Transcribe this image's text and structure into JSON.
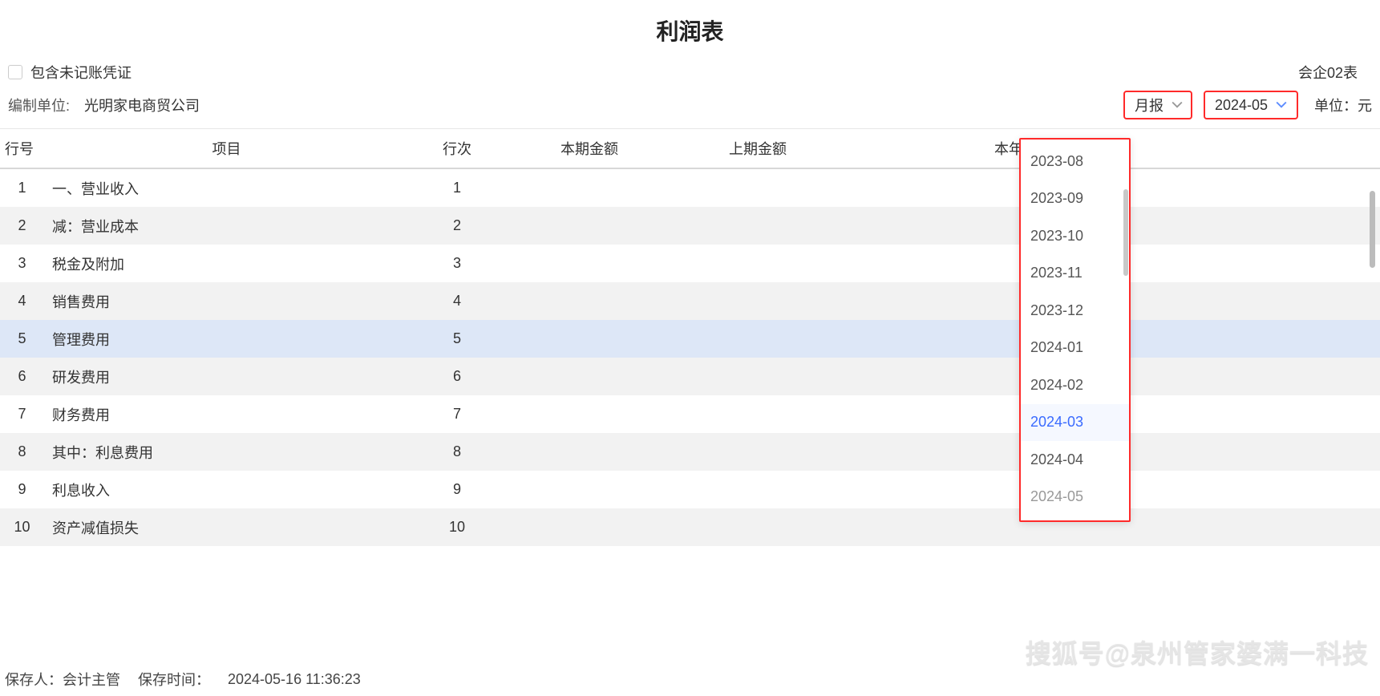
{
  "title": "利润表",
  "checkbox_label": "包含未记账凭证",
  "form_code_label": "会企02表",
  "org": {
    "label": "编制单位:",
    "value": "光明家电商贸公司"
  },
  "selectors": {
    "report_type": "月报",
    "period": "2024-05"
  },
  "unit_label": "单位：元",
  "columns": {
    "row_no": "行号",
    "item": "项目",
    "line_no": "行次",
    "current_amount": "本期金额",
    "prior_amount": "上期金额",
    "ytd_amount": "本年金额",
    "last_col": ""
  },
  "rows": [
    {
      "no": "1",
      "item": "一、营业收入",
      "indent": 0,
      "line": "1",
      "curr": "",
      "prior": "",
      "ytd": ""
    },
    {
      "no": "2",
      "item": "减：营业成本",
      "indent": 1,
      "line": "2",
      "curr": "",
      "prior": "",
      "ytd": ""
    },
    {
      "no": "3",
      "item": "税金及附加",
      "indent": 2,
      "line": "3",
      "curr": "",
      "prior": "",
      "ytd": ""
    },
    {
      "no": "4",
      "item": "销售费用",
      "indent": 2,
      "line": "4",
      "curr": "",
      "prior": "",
      "ytd": ""
    },
    {
      "no": "5",
      "item": "管理费用",
      "indent": 2,
      "line": "5",
      "curr": "",
      "prior": "",
      "ytd": ""
    },
    {
      "no": "6",
      "item": "研发费用",
      "indent": 2,
      "line": "6",
      "curr": "",
      "prior": "",
      "ytd": ""
    },
    {
      "no": "7",
      "item": "财务费用",
      "indent": 2,
      "line": "7",
      "curr": "",
      "prior": "",
      "ytd": ""
    },
    {
      "no": "8",
      "item": "其中：利息费用",
      "indent": 3,
      "line": "8",
      "curr": "",
      "prior": "",
      "ytd": ""
    },
    {
      "no": "9",
      "item": "利息收入",
      "indent": 4,
      "line": "9",
      "curr": "",
      "prior": "",
      "ytd": ""
    },
    {
      "no": "10",
      "item": "资产减值损失",
      "indent": 2,
      "line": "10",
      "curr": "",
      "prior": "",
      "ytd": ""
    }
  ],
  "dropdown_options": [
    "2023-08",
    "2023-09",
    "2023-10",
    "2023-11",
    "2023-12",
    "2024-01",
    "2024-02",
    "2024-03",
    "2024-04",
    "2024-05"
  ],
  "dropdown_active": "2024-03",
  "footer": {
    "saver_label": "保存人：",
    "saver_value": "会计主管",
    "time_label": "保存时间：",
    "time_value": "2024-05-16 11:36:23"
  },
  "watermark": "搜狐号@泉州管家婆满一科技"
}
